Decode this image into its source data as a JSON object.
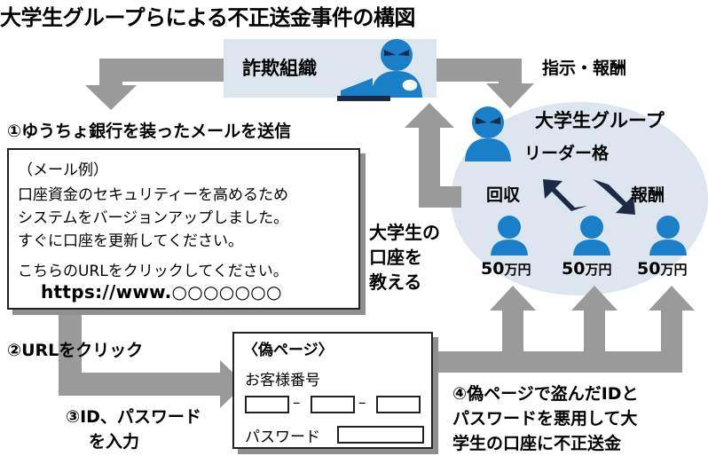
{
  "title": "大学生グループらによる不正送金事件の構図",
  "fraud_org": {
    "label": "詐欺組織"
  },
  "arrow_labels": {
    "instruction_reward": "指示・報酬",
    "teach_accounts_lines": [
      "大学生の",
      "口座を",
      "教える"
    ]
  },
  "steps": {
    "step1": "①ゆうちょ銀行を装ったメールを送信",
    "step2": "②URLをクリック",
    "step3_lines": [
      "③ID、パスワード",
      "を入力"
    ],
    "step4_lines": [
      "④偽ページで盗んだIDと",
      "パスワードを悪用して大",
      "学生の口座に不正送金"
    ]
  },
  "email_example": {
    "lines": [
      "（メール例）",
      "口座資金のセキュリティーを高めるため",
      "システムをバージョンアップしました。",
      "すぐに口座を更新してください。",
      "こちらのURLをクリックしてください。"
    ],
    "url": "https://www.○○○○○○○"
  },
  "fake_page": {
    "title": "〈偽ページ〉",
    "customer_number_label": "お客様番号",
    "separator": "–",
    "password_label": "パスワード"
  },
  "student_group": {
    "title": "大学生グループ",
    "leader_label": "リーダー格",
    "collect_label": "回収",
    "reward_label": "報酬",
    "amounts": [
      {
        "value": "50",
        "unit": "万円"
      },
      {
        "value": "50",
        "unit": "万円"
      },
      {
        "value": "50",
        "unit": "万円"
      }
    ]
  },
  "colors": {
    "arrow_gray": "#9a9a9a",
    "light_blue_bg": "#dde6ef",
    "figure_blue": "#1a7fc9",
    "dark_navy": "#1d2a44"
  },
  "icons": [
    "hacker-figure-icon",
    "laptop-icon",
    "person-icon",
    "diagonal-arrow-icon"
  ]
}
